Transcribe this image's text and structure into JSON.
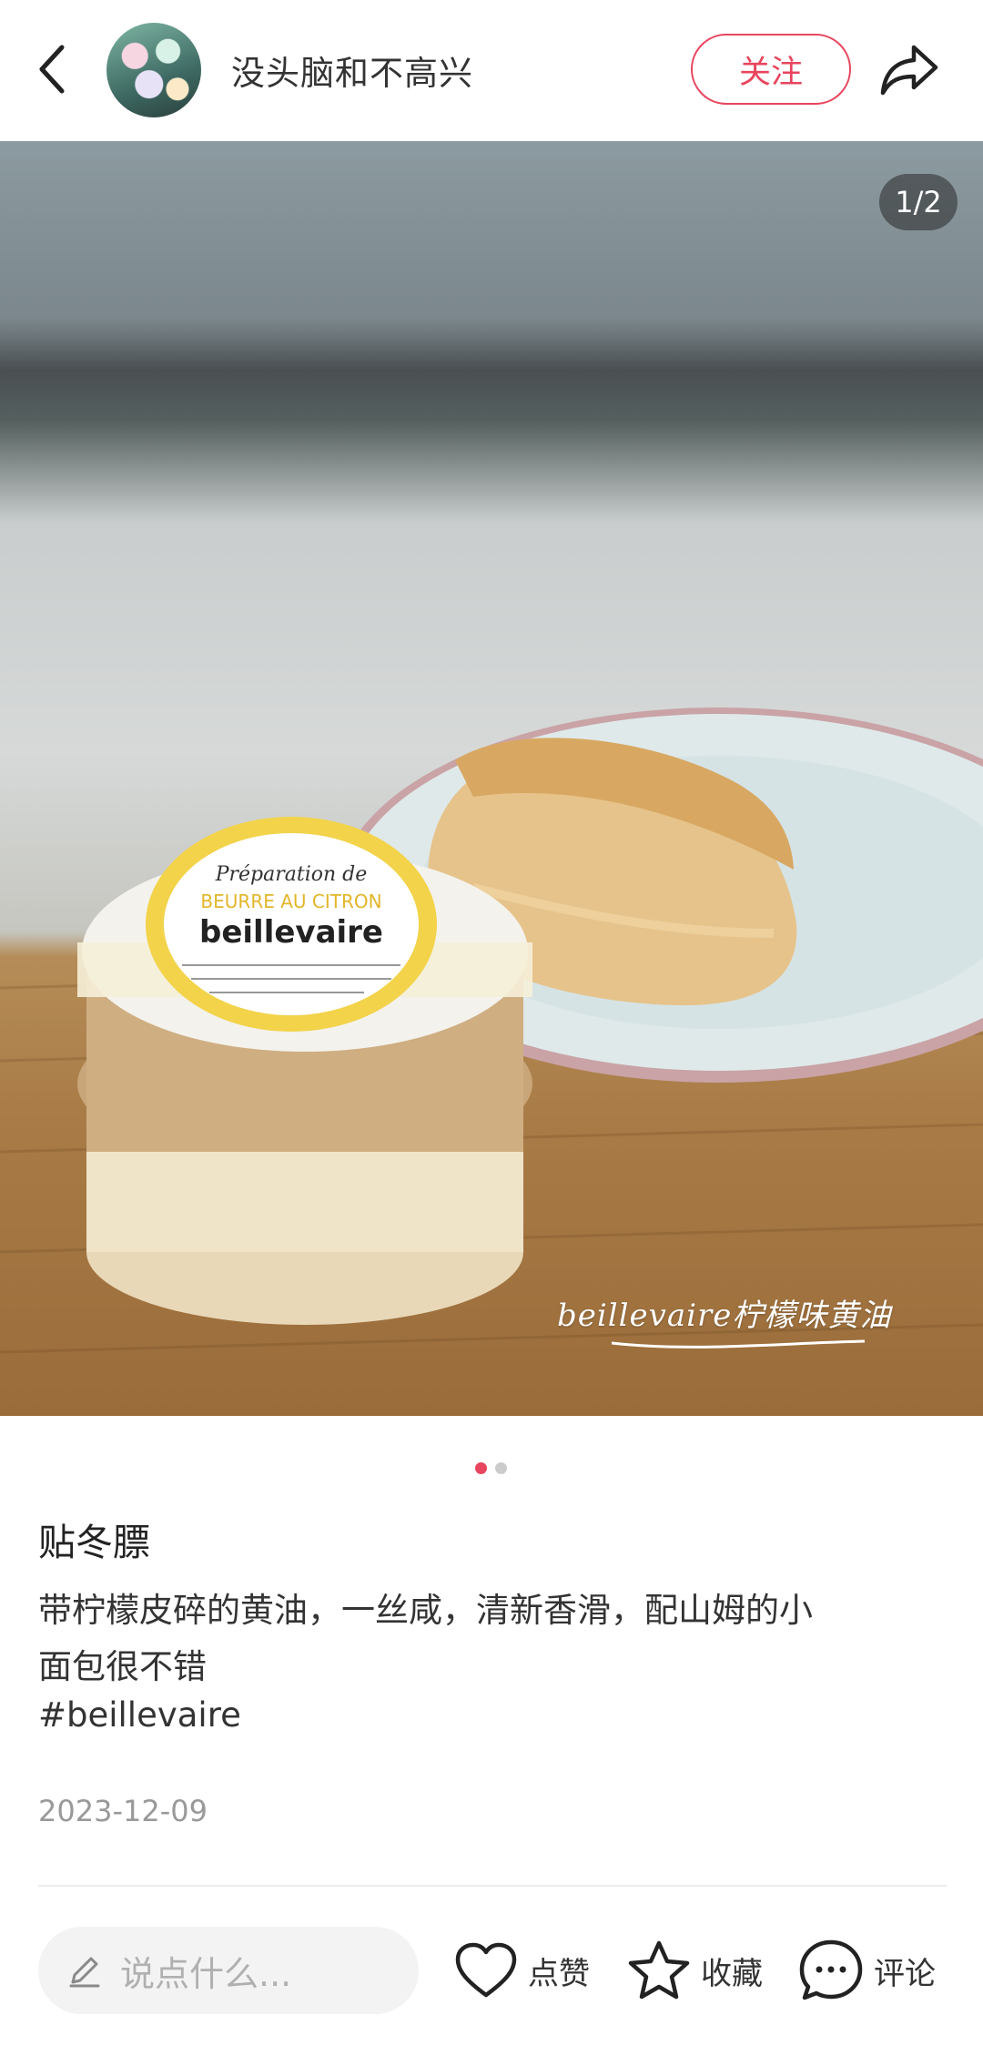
{
  "header": {
    "username": "没头脑和不高兴",
    "follow_label": "关注"
  },
  "photo": {
    "counter": "1/2",
    "caption": "beillevaire柠檬味黄油",
    "package_text_1": "Préparation de",
    "package_text_2": "BEURRE AU CITRON",
    "brand": "beillevaire"
  },
  "pager": {
    "current": 1,
    "total": 2,
    "active_color": "#e8455e",
    "inactive_color": "#cccccc"
  },
  "post": {
    "title": "贴冬膘",
    "body_line1": "带柠檬皮碎的黄油，一丝咸，清新香滑，配山姆的小",
    "body_line2": "面包很不错",
    "hashtag": "#beillevaire",
    "date": "2023-12-09"
  },
  "bottom_bar": {
    "input_placeholder": "说点什么...",
    "like_label": "点赞",
    "collect_label": "收藏",
    "comment_label": "评论"
  },
  "colors": {
    "accent": "#e8455e"
  }
}
